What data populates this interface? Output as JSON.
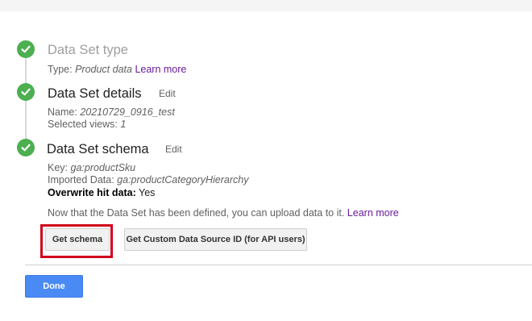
{
  "steps": [
    {
      "title": "Data Set type",
      "details": {
        "type_label": "Type:",
        "type_value": "Product data",
        "learn_more": "Learn more"
      }
    },
    {
      "title": "Data Set details",
      "edit": "Edit",
      "details": {
        "name_label": "Name:",
        "name_value": "20210729_0916_test",
        "views_label": "Selected views:",
        "views_value": "1"
      }
    },
    {
      "title": "Data Set schema",
      "edit": "Edit",
      "details": {
        "key_label": "Key:",
        "key_value": "ga:productSku",
        "imported_label": "Imported Data:",
        "imported_value": "ga:productCategoryHierarchy",
        "overwrite_label": "Overwrite hit data:",
        "overwrite_value": "Yes"
      }
    }
  ],
  "upload_message": "Now that the Data Set has been defined, you can upload data to it.",
  "upload_link": "Learn more",
  "buttons": {
    "get_schema": "Get schema",
    "get_custom_id": "Get Custom Data Source ID (for API users)",
    "done": "Done"
  },
  "colors": {
    "check": "#4caf50",
    "link": "#6a1b9a",
    "done": "#4a8af4",
    "highlight": "#d0021b"
  },
  "icons": {
    "step_complete": "check-circle-icon"
  }
}
